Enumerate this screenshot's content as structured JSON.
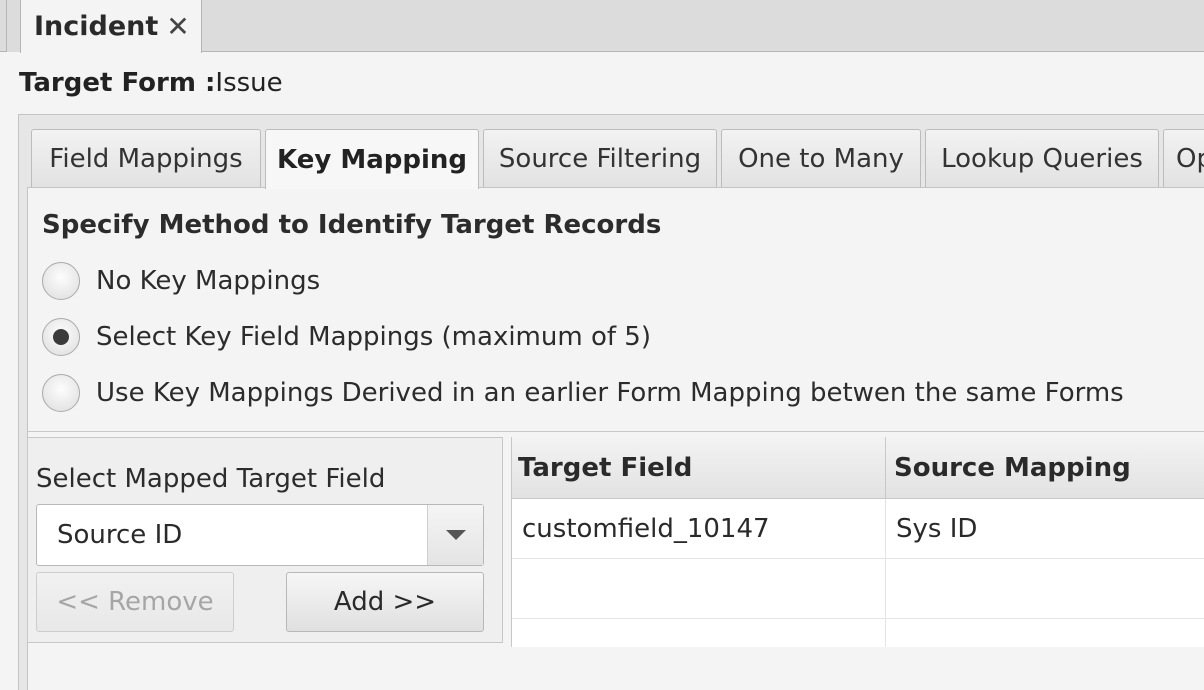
{
  "document_tab": {
    "label": "Incident",
    "close": "✕"
  },
  "target_form": {
    "label": "Target Form :",
    "value": "Issue"
  },
  "tabs": [
    {
      "label": "Field Mappings",
      "active": false
    },
    {
      "label": "Key Mapping",
      "active": true
    },
    {
      "label": "Source Filtering",
      "active": false
    },
    {
      "label": "One to Many",
      "active": false
    },
    {
      "label": "Lookup Queries",
      "active": false
    },
    {
      "label": "Op",
      "active": false
    }
  ],
  "key_mapping": {
    "title": "Specify Method to Identify Target Records",
    "options": [
      {
        "label": "No Key Mappings",
        "checked": false
      },
      {
        "label": "Select Key Field Mappings (maximum of 5)",
        "checked": true
      },
      {
        "label": "Use Key Mappings Derived in an earlier Form Mapping betwen the same Forms",
        "checked": false
      }
    ]
  },
  "selector": {
    "label": "Select Mapped Target Field",
    "selected": "Source ID",
    "remove_label": "<< Remove",
    "add_label": "Add >>"
  },
  "grid": {
    "columns": [
      "Target Field",
      "Source Mapping"
    ],
    "rows": [
      [
        "customfield_10147",
        "Sys ID"
      ],
      [
        "",
        ""
      ],
      [
        "",
        ""
      ]
    ]
  }
}
